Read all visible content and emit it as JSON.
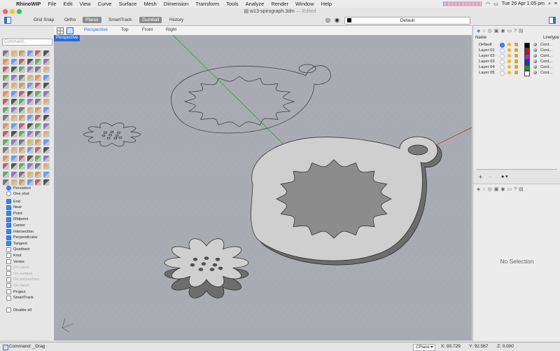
{
  "menubar": {
    "app": "RhinoWIP",
    "items": [
      "File",
      "Edit",
      "View",
      "Curve",
      "Surface",
      "Mesh",
      "Dimension",
      "Transform",
      "Tools",
      "Analyze",
      "Render",
      "Window",
      "Help"
    ],
    "datetime": "Tue 26 Apr  1:05 pm"
  },
  "window": {
    "title": "w13-spirograph.3dm",
    "edited": "— Edited"
  },
  "toolbar": {
    "grid_snap": "Grid Snap",
    "ortho": "Ortho",
    "planar": "Planar",
    "smarttrack": "SmartTrack",
    "gumball": "Gumball",
    "history": "History",
    "layer_current": "Default"
  },
  "viewport": {
    "tabs": [
      "Perspective",
      "Top",
      "Front",
      "Right"
    ],
    "active_tab": "Perspective",
    "label": "Perspective"
  },
  "toolbox": {
    "command_placeholder": "Command..."
  },
  "osnap": {
    "persistent": "Persistent",
    "one_shot": "One shot",
    "items": [
      {
        "label": "End",
        "checked": true,
        "enabled": true
      },
      {
        "label": "Near",
        "checked": true,
        "enabled": true
      },
      {
        "label": "Point",
        "checked": true,
        "enabled": true
      },
      {
        "label": "Midpoint",
        "checked": true,
        "enabled": true
      },
      {
        "label": "Center",
        "checked": true,
        "enabled": true
      },
      {
        "label": "Intersection",
        "checked": true,
        "enabled": true
      },
      {
        "label": "Perpendicular",
        "checked": true,
        "enabled": true
      },
      {
        "label": "Tangent",
        "checked": true,
        "enabled": true
      },
      {
        "label": "Quadrant",
        "checked": false,
        "enabled": true
      },
      {
        "label": "Knot",
        "checked": false,
        "enabled": true
      },
      {
        "label": "Vertex",
        "checked": false,
        "enabled": true
      },
      {
        "label": "On curve",
        "checked": false,
        "enabled": false
      },
      {
        "label": "On surface",
        "checked": false,
        "enabled": false
      },
      {
        "label": "On polysurface",
        "checked": false,
        "enabled": false
      },
      {
        "label": "On mesh",
        "checked": false,
        "enabled": false
      },
      {
        "label": "Project",
        "checked": false,
        "enabled": true
      },
      {
        "label": "SmartTrack",
        "checked": false,
        "enabled": true
      }
    ],
    "disable_all": "Disable all"
  },
  "layers": {
    "header_name": "Name",
    "header_linetype": "Linetype",
    "rows": [
      {
        "name": "Default",
        "color": "#000000",
        "linetype": "Cont..."
      },
      {
        "name": "Layer 01",
        "color": "#d01010",
        "linetype": "Cont..."
      },
      {
        "name": "Layer 02",
        "color": "#9b30c8",
        "linetype": "Cont..."
      },
      {
        "name": "Layer 03",
        "color": "#1a30d0",
        "linetype": "Cont..."
      },
      {
        "name": "Layer 04",
        "color": "#10a020",
        "linetype": "Cont..."
      },
      {
        "name": "Layer 05",
        "color": "#ffffff",
        "linetype": "Cont..."
      }
    ]
  },
  "properties": {
    "empty": "No Selection"
  },
  "statusbar": {
    "command": "Command: _Drag",
    "cplane": "CPlane",
    "x": "X: 93.729",
    "y": "Y: 92.567",
    "z": "Z: 0.000"
  }
}
